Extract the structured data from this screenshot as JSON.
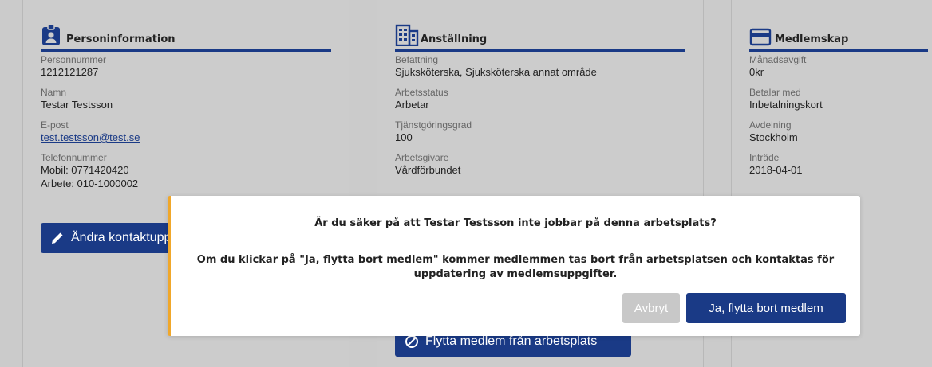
{
  "person": {
    "title": "Personinformation",
    "icon": "id-badge-icon",
    "fields": [
      {
        "label": "Personnummer",
        "value": "1212121287"
      },
      {
        "label": "Namn",
        "value": "Testar Testsson"
      },
      {
        "label": "E-post",
        "value": "test.testsson@test.se"
      },
      {
        "label": "Telefonnummer",
        "value": "Mobil: 0771420420",
        "value2": "Arbete: 010-1000002"
      }
    ],
    "edit_label": "Ändra kontaktuppgifter"
  },
  "employment": {
    "title": "Anställning",
    "icon": "building-icon",
    "fields": [
      {
        "label": "Befattning",
        "value": "Sjuksköterska, Sjuksköterska annat område"
      },
      {
        "label": "Arbetsstatus",
        "value": "Arbetar"
      },
      {
        "label": "Tjänstgöringsgrad",
        "value": "100"
      },
      {
        "label": "Arbetsgivare",
        "value": "Vårdförbundet"
      }
    ],
    "move_label": "Flytta medlem från arbetsplats"
  },
  "membership": {
    "title": "Medlemskap",
    "icon": "card-icon",
    "fields": [
      {
        "label": "Månadsavgift",
        "value": "0kr"
      },
      {
        "label": "Betalar med",
        "value": "Inbetalningskort"
      },
      {
        "label": "Avdelning",
        "value": "Stockholm"
      },
      {
        "label": "Inträde",
        "value": "2018-04-01"
      }
    ]
  },
  "modal": {
    "question": "Är du säker på att Testar Testsson inte jobbar på denna arbetsplats?",
    "message": "Om du klickar på \"Ja, flytta bort medlem\" kommer medlemmen tas bort från arbetsplatsen och kontaktas för uppdatering av medlemsuppgifter.",
    "cancel_label": "Avbryt",
    "confirm_label": "Ja, flytta bort medlem"
  },
  "colors": {
    "primary": "#1a3a86",
    "warning": "#f0a72a",
    "background": "#cccccc",
    "disabled": "#c8c8c8"
  }
}
